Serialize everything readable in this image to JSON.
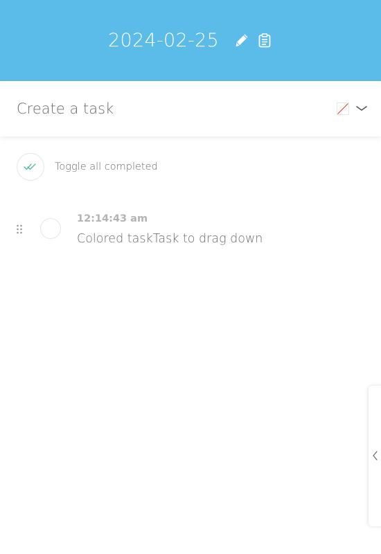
{
  "header": {
    "date": "2024-02-25",
    "background_color": "#5bbbe9",
    "edit_icon": "pencil-icon",
    "clipboard_icon": "clipboard-icon"
  },
  "create_task": {
    "placeholder": "Create a task",
    "value": "",
    "color_swatch": "no-color",
    "dropdown_icon": "chevron-down-icon"
  },
  "toggle_all": {
    "label": "Toggle all completed",
    "icon": "double-check-icon",
    "icon_color": "#4ab9a0"
  },
  "tasks": [
    {
      "time": "12:14:43 am",
      "text": "Colored taskTask to drag down",
      "completed": false
    }
  ],
  "side_drawer": {
    "icon": "chevron-left-icon"
  }
}
